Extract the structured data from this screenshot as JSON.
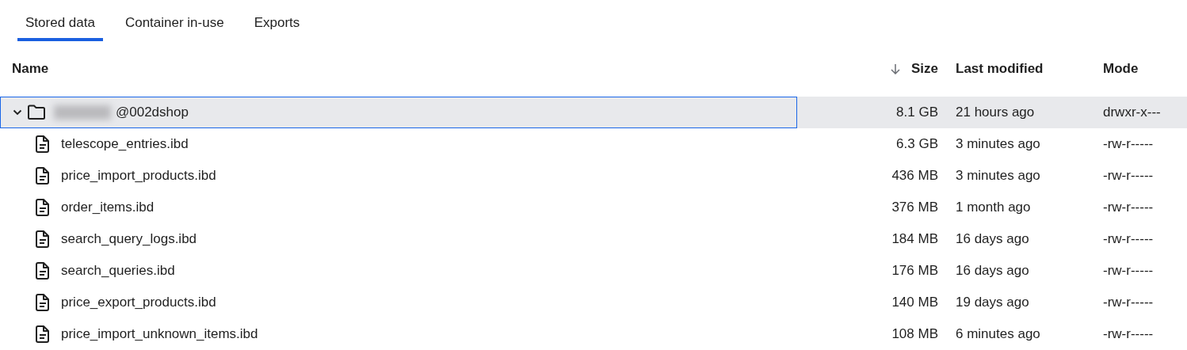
{
  "tabs": [
    {
      "label": "Stored data",
      "selected": true
    },
    {
      "label": "Container in-use",
      "selected": false
    },
    {
      "label": "Exports",
      "selected": false
    }
  ],
  "table": {
    "columns": [
      {
        "label": "Name",
        "sorted": false
      },
      {
        "label": "Size",
        "sorted": true
      },
      {
        "label": "Last modified",
        "sorted": false
      },
      {
        "label": "Mode",
        "sorted": false
      }
    ],
    "rows": [
      {
        "kind": "folder",
        "name": "@002dshop",
        "redacted": true,
        "size": "8.1 GB",
        "modified": "21 hours ago",
        "mode": "drwxr-x---",
        "expanded": true,
        "selected": true,
        "children": [
          {
            "kind": "file",
            "name": "telescope_entries.ibd",
            "size": "6.3 GB",
            "modified": "3 minutes ago",
            "mode": "-rw-r-----",
            "selected": false
          },
          {
            "kind": "file",
            "name": "price_import_products.ibd",
            "size": "436 MB",
            "modified": "3 minutes ago",
            "mode": "-rw-r-----",
            "selected": false
          },
          {
            "kind": "file",
            "name": "order_items.ibd",
            "size": "376 MB",
            "modified": "1 month ago",
            "mode": "-rw-r-----",
            "selected": false
          },
          {
            "kind": "file",
            "name": "search_query_logs.ibd",
            "size": "184 MB",
            "modified": "16 days ago",
            "mode": "-rw-r-----",
            "selected": false
          },
          {
            "kind": "file",
            "name": "search_queries.ibd",
            "size": "176 MB",
            "modified": "16 days ago",
            "mode": "-rw-r-----",
            "selected": false
          },
          {
            "kind": "file",
            "name": "price_export_products.ibd",
            "size": "140 MB",
            "modified": "19 days ago",
            "mode": "-rw-r-----",
            "selected": false
          },
          {
            "kind": "file",
            "name": "price_import_unknown_items.ibd",
            "size": "108 MB",
            "modified": "6 minutes ago",
            "mode": "-rw-r-----",
            "selected": false
          }
        ]
      }
    ]
  }
}
